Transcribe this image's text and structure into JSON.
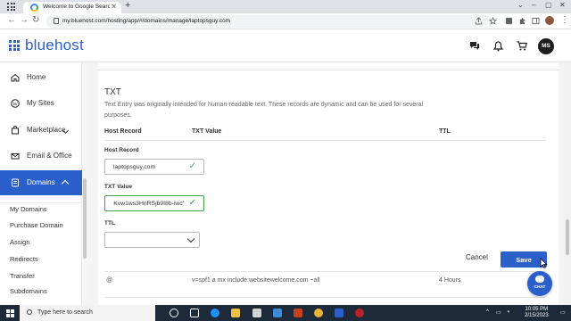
{
  "browser": {
    "tab_title": "Welcome to Google Search Cons",
    "url": "my.bluehost.com/hosting/app/#/domains/manage/laptopsguy.com"
  },
  "header": {
    "logo": "bluehost",
    "avatar_initials": "MS"
  },
  "sidebar": {
    "items": [
      {
        "label": "Home",
        "icon": "home-icon"
      },
      {
        "label": "My Sites",
        "icon": "wordpress-icon"
      },
      {
        "label": "Marketplace",
        "icon": "bag-icon"
      },
      {
        "label": "Email & Office",
        "icon": "mail-icon"
      },
      {
        "label": "Domains",
        "icon": "domains-icon"
      }
    ],
    "sub_items": [
      "My Domains",
      "Purchase Domain",
      "Assign",
      "Redirects",
      "Transfer",
      "Subdomains"
    ]
  },
  "dns_form": {
    "type": "TXT",
    "description": "Text Entry was originally intended for human-readable text. These records are dynamic and can be used for several purposes.",
    "columns": [
      "Host Record",
      "TXT Value",
      "TTL"
    ],
    "host_label": "Host Record",
    "host_value": "laptopsguy.com",
    "txt_label": "TXT Value",
    "txt_value": "'Kvw1ws3HnRSjb9I8b-iwc",
    "ttl_label": "TTL",
    "ttl_value": "",
    "cancel_label": "Cancel",
    "save_label": "Save"
  },
  "records": [
    {
      "host": "@",
      "value": "v=spf1 a mx include:websitewelcome.com ~all",
      "ttl": "4 Hours"
    }
  ],
  "chat_label": "CHAT",
  "taskbar": {
    "search_placeholder": "Type here to search",
    "time": "10:05 PM",
    "date": "2/15/2023"
  },
  "colors": {
    "brand": "#2b5fc9",
    "valid": "#3fa34d"
  }
}
